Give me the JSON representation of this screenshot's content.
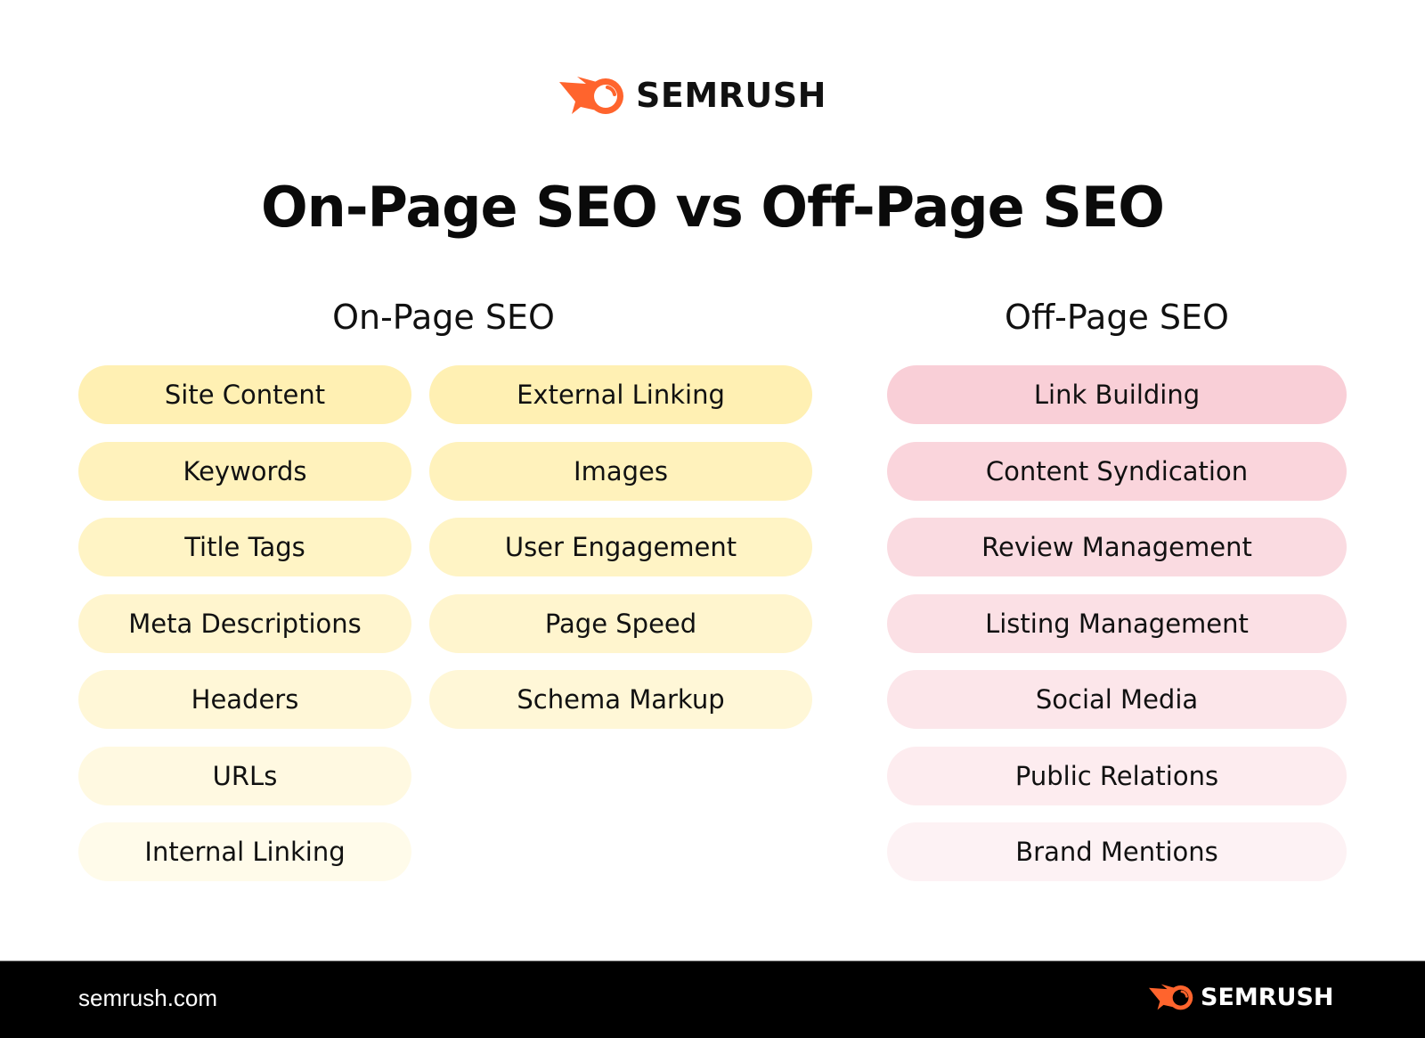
{
  "brand": {
    "name": "SEMRUSH",
    "accent_color": "#FF642D"
  },
  "title": "On-Page SEO vs Off-Page SEO",
  "columns": {
    "on_page": {
      "heading": "On-Page SEO",
      "color": "#FFF0B3",
      "left_items": [
        "Site Content",
        "Keywords",
        "Title Tags",
        "Meta Descriptions",
        "Headers",
        "URLs",
        "Internal Linking"
      ],
      "right_items": [
        "External Linking",
        "Images",
        "User Engagement",
        "Page Speed",
        "Schema Markup"
      ]
    },
    "off_page": {
      "heading": "Off-Page SEO",
      "color": "#F9CFD7",
      "items": [
        "Link Building",
        "Content Syndication",
        "Review Management",
        "Listing Management",
        "Social Media",
        "Public Relations",
        "Brand Mentions"
      ]
    }
  },
  "footer": {
    "url": "semrush.com",
    "brand": "SEMRUSH"
  }
}
